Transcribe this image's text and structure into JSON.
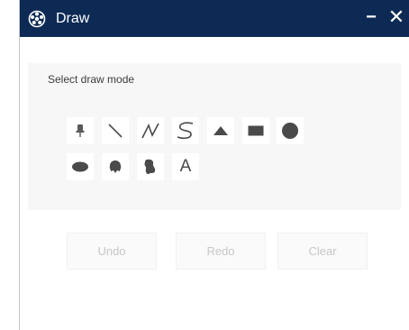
{
  "window": {
    "title": "Draw",
    "minimize_label": "−",
    "close_label": "✕",
    "app_icon": "sketch-widget-icon"
  },
  "panel": {
    "label": "Select draw mode",
    "tools": [
      {
        "name": "point",
        "icon": "pushpin-icon"
      },
      {
        "name": "line",
        "icon": "line-icon"
      },
      {
        "name": "polyline",
        "icon": "polyline-icon"
      },
      {
        "name": "freehand-polyline",
        "icon": "freehand-line-icon"
      },
      {
        "name": "triangle",
        "icon": "triangle-icon"
      },
      {
        "name": "rectangle",
        "icon": "rectangle-icon"
      },
      {
        "name": "circle",
        "icon": "circle-icon"
      },
      {
        "name": "ellipse",
        "icon": "ellipse-icon"
      },
      {
        "name": "polygon",
        "icon": "polygon-icon"
      },
      {
        "name": "freehand-polygon",
        "icon": "freehand-polygon-icon"
      },
      {
        "name": "text",
        "icon": "text-icon",
        "label": "A"
      }
    ]
  },
  "actions": {
    "undo": "Undo",
    "redo": "Redo",
    "clear": "Clear"
  },
  "colors": {
    "titlebar": "#0d2a55",
    "panel_bg": "#f7f7f7",
    "icon": "#4a4a4a",
    "disabled_text": "#c7c7c7"
  }
}
